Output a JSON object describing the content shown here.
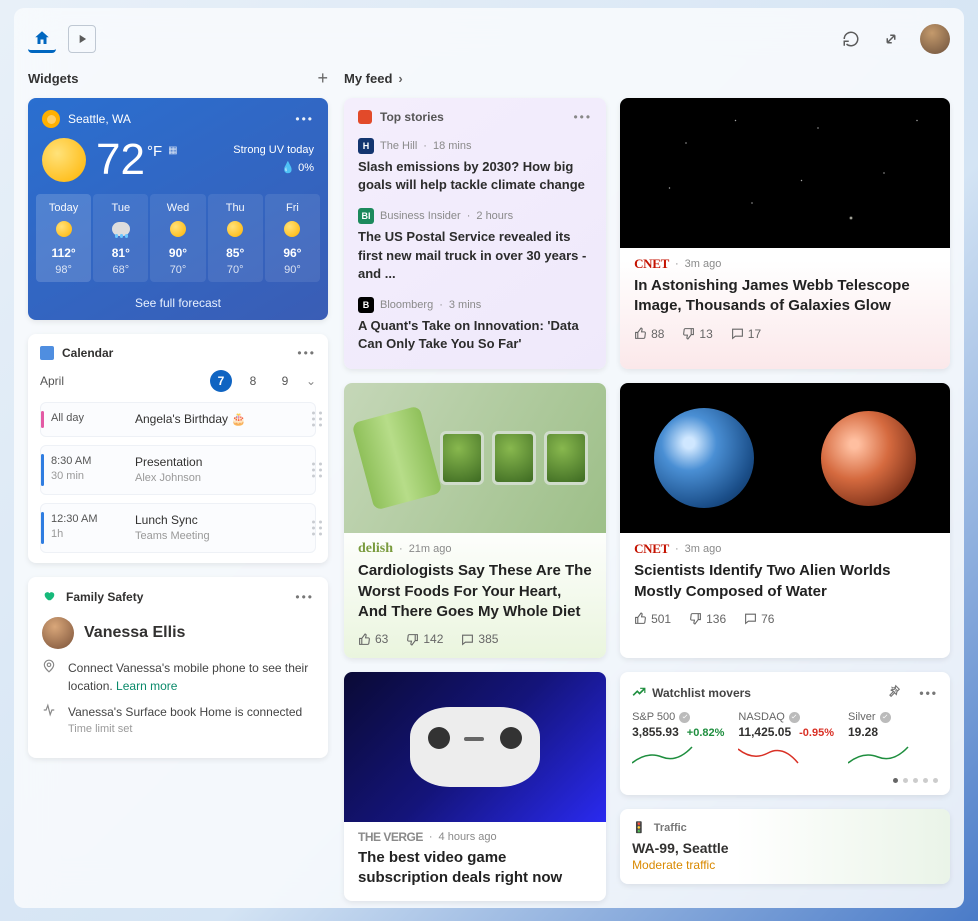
{
  "header": {
    "widgets_label": "Widgets",
    "feed_label": "My feed"
  },
  "weather": {
    "location": "Seattle, WA",
    "temp": "72",
    "unit": "°F",
    "alert": "Strong UV today",
    "precip": "0%",
    "forecast_link": "See full forecast",
    "days": [
      {
        "name": "Today",
        "hi": "112°",
        "lo": "98°",
        "icon": "partly"
      },
      {
        "name": "Tue",
        "hi": "81°",
        "lo": "68°",
        "icon": "rain"
      },
      {
        "name": "Wed",
        "hi": "90°",
        "lo": "70°",
        "icon": "sun"
      },
      {
        "name": "Thu",
        "hi": "85°",
        "lo": "70°",
        "icon": "sun"
      },
      {
        "name": "Fri",
        "hi": "96°",
        "lo": "90°",
        "icon": "sun"
      }
    ]
  },
  "calendar": {
    "title": "Calendar",
    "month": "April",
    "dates": [
      "7",
      "8",
      "9"
    ],
    "events": [
      {
        "time": "All day",
        "duration": "",
        "title": "Angela's Birthday 🎂",
        "sub": "",
        "color": "pink"
      },
      {
        "time": "8:30 AM",
        "duration": "30 min",
        "title": "Presentation",
        "sub": "Alex Johnson",
        "color": "blue"
      },
      {
        "time": "12:30 AM",
        "duration": "1h",
        "title": "Lunch Sync",
        "sub": "Teams Meeting",
        "color": "blue"
      }
    ]
  },
  "family": {
    "title": "Family Safety",
    "name": "Vanessa Ellis",
    "line1": "Connect Vanessa's mobile phone to see their location.",
    "line1_link": "Learn more",
    "line2": "Vanessa's Surface book Home is connected",
    "line2_sub": "Time limit set"
  },
  "topstories": {
    "title": "Top stories",
    "items": [
      {
        "source": "The Hill",
        "time": "18 mins",
        "logo_bg": "#13356f",
        "logo_txt": "H",
        "headline": "Slash emissions by 2030? How big goals will help tackle climate change"
      },
      {
        "source": "Business Insider",
        "time": "2 hours",
        "logo_bg": "#1c8a5c",
        "logo_txt": "BI",
        "headline": "The US Postal Service revealed its first new mail truck in over 30 years - and ..."
      },
      {
        "source": "Bloomberg",
        "time": "3 mins",
        "logo_bg": "#000",
        "logo_txt": "B",
        "headline": "A Quant's Take on Innovation: 'Data Can Only Take You So Far'"
      }
    ]
  },
  "news": {
    "webb": {
      "source": "CNET",
      "time": "3m ago",
      "title": "In Astonishing James Webb Telescope Image, Thousands of Galaxies Glow",
      "likes": "88",
      "dislikes": "13",
      "comments": "17"
    },
    "delish": {
      "source": "delish",
      "time": "21m ago",
      "title": "Cardiologists Say These Are The Worst Foods For Your Heart, And There Goes My Whole Diet",
      "likes": "63",
      "dislikes": "142",
      "comments": "385"
    },
    "aliens": {
      "source": "CNET",
      "time": "3m ago",
      "title": "Scientists Identify Two Alien Worlds Mostly Composed of Water",
      "likes": "501",
      "dislikes": "136",
      "comments": "76"
    },
    "verge": {
      "source": "THE VERGE",
      "time": "4 hours ago",
      "title": "The best video game subscription deals right now"
    }
  },
  "watchlist": {
    "title": "Watchlist movers",
    "stocks": [
      {
        "name": "S&P 500",
        "val": "3,855.93",
        "chg": "+0.82%",
        "dir": "up"
      },
      {
        "name": "NASDAQ",
        "val": "11,425.05",
        "chg": "-0.95%",
        "dir": "down"
      },
      {
        "name": "Silver",
        "val": "19.28",
        "chg": "",
        "dir": "up"
      }
    ]
  },
  "traffic": {
    "title": "Traffic",
    "route": "WA-99, Seattle",
    "status": "Moderate traffic"
  }
}
